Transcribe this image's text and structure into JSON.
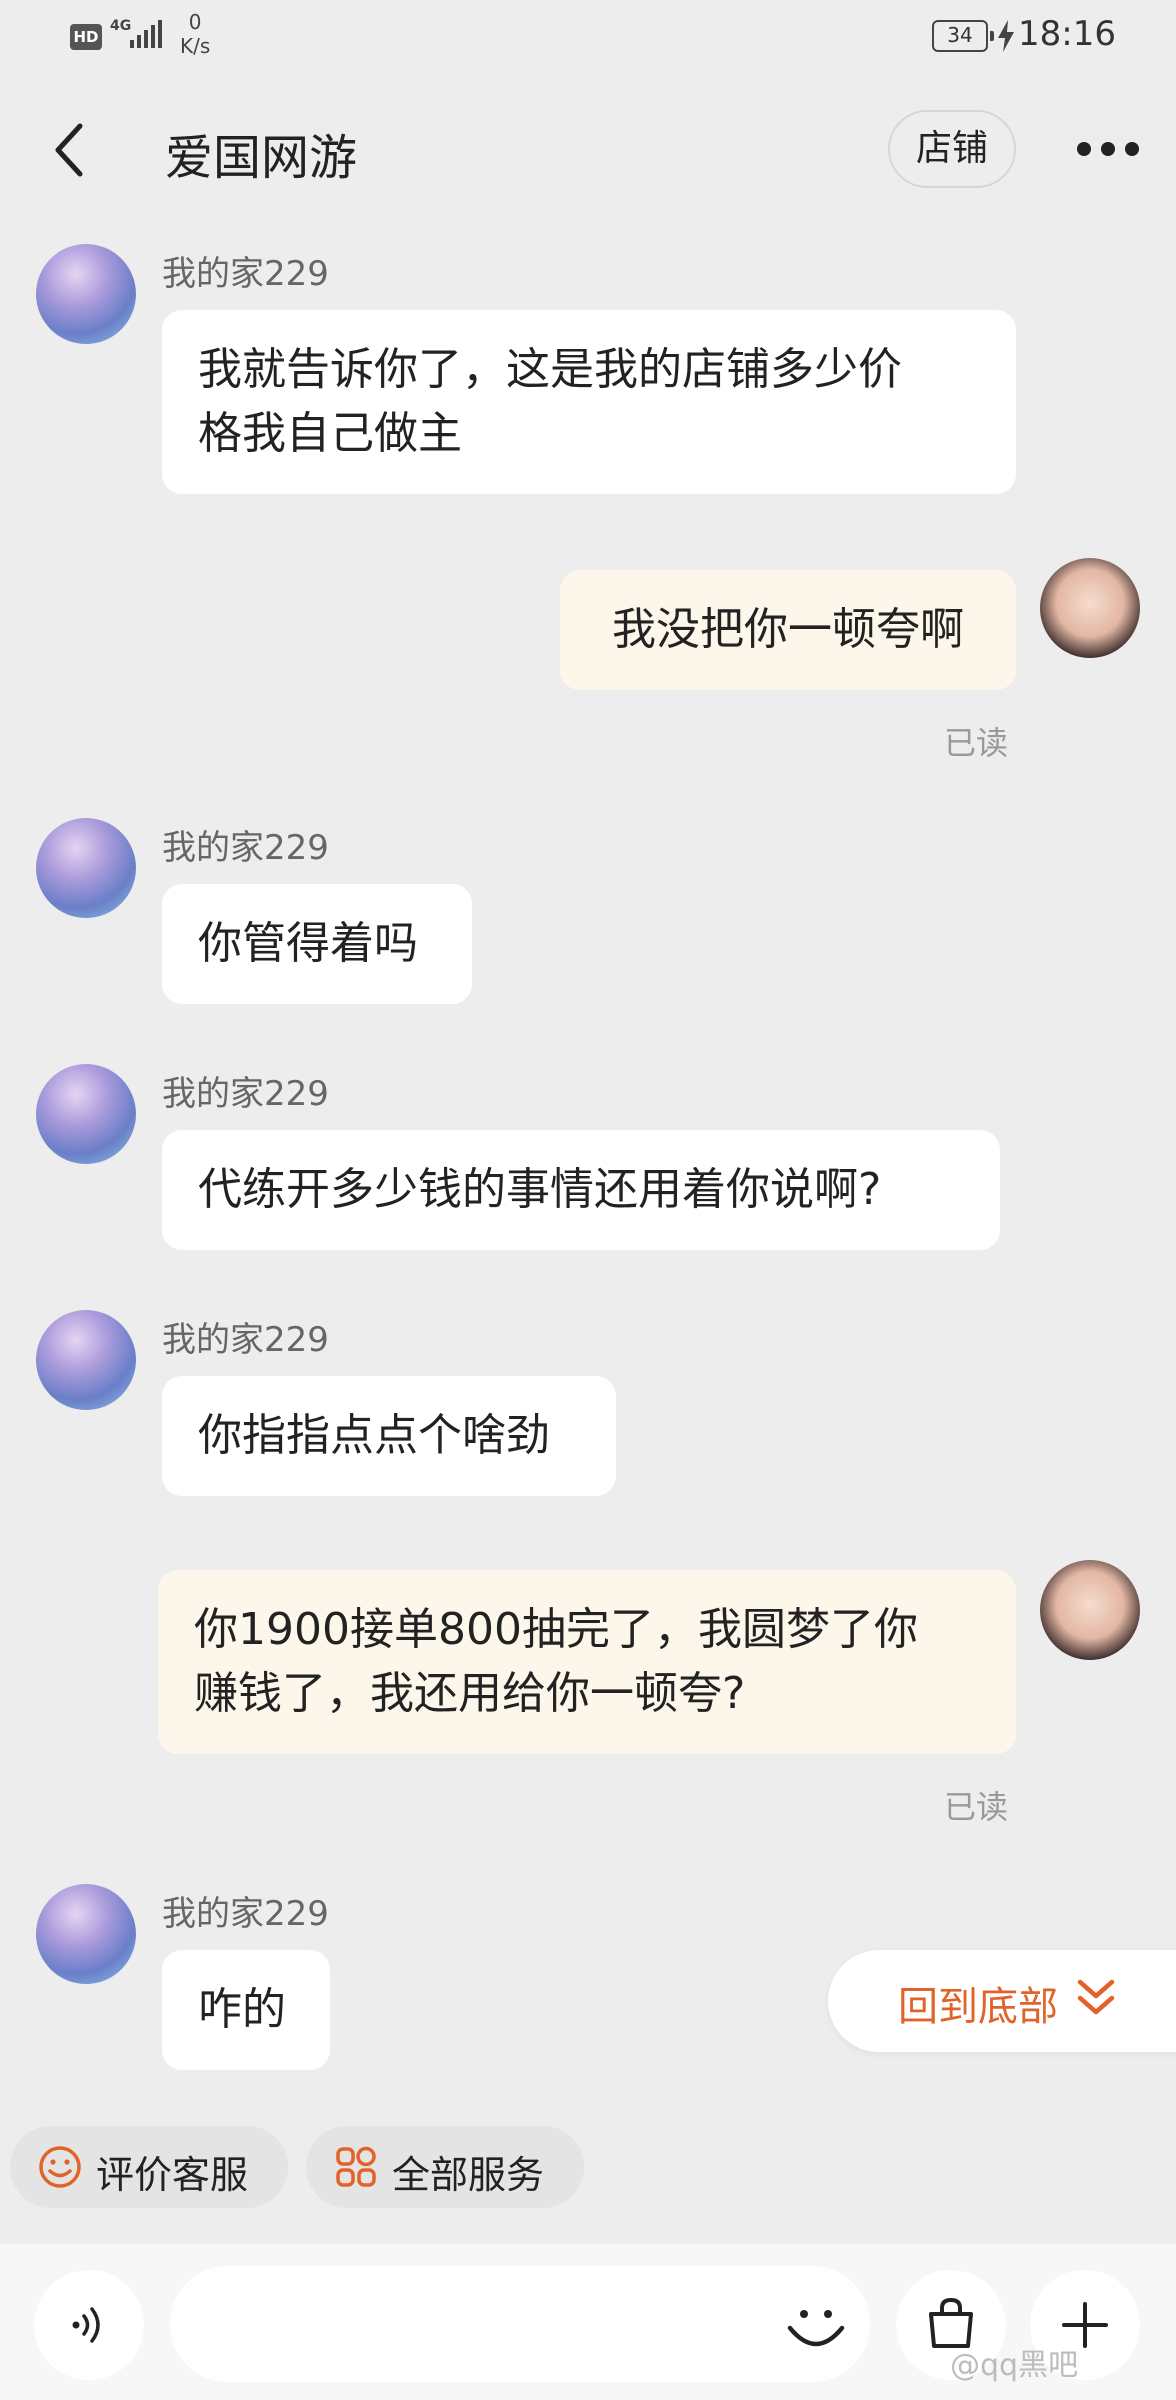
{
  "status_bar": {
    "hd": "HD",
    "network": "4G",
    "speed_value": "0",
    "speed_unit": "K/s",
    "battery": "34",
    "time": "18:16"
  },
  "header": {
    "title": "爱国网游",
    "shop_label": "店铺"
  },
  "messages": [
    {
      "side": "in",
      "sender": "我的家229",
      "text_lines": [
        "我就告诉你了，这是我的店铺多少价",
        "格我自己做主"
      ]
    },
    {
      "side": "out",
      "text_lines": [
        "我没把你一顿夸啊"
      ],
      "status": "已读"
    },
    {
      "side": "in",
      "sender": "我的家229",
      "text_lines": [
        "你管得着吗"
      ]
    },
    {
      "side": "in",
      "sender": "我的家229",
      "text_lines": [
        "代练开多少钱的事情还用着你说啊?"
      ]
    },
    {
      "side": "in",
      "sender": "我的家229",
      "text_lines": [
        "你指指点点个啥劲"
      ]
    },
    {
      "side": "out",
      "text_lines": [
        "你1900接单800抽完了，我圆梦了你",
        "赚钱了，我还用给你一顿夸?"
      ],
      "status": "已读"
    },
    {
      "side": "in",
      "sender": "我的家229",
      "text_lines": [
        "咋的"
      ]
    }
  ],
  "scroll_to_bottom": {
    "label": "回到底部"
  },
  "quick_actions": [
    {
      "label": "评价客服",
      "icon": "smiley-icon"
    },
    {
      "label": "全部服务",
      "icon": "grid-icon"
    }
  ],
  "input": {
    "placeholder": ""
  },
  "watermark": "@qq黑吧",
  "colors": {
    "accent": "#e2632a",
    "outgoing_bubble": "#fcf7ea",
    "incoming_bubble": "#ffffff",
    "background": "#ededed"
  }
}
